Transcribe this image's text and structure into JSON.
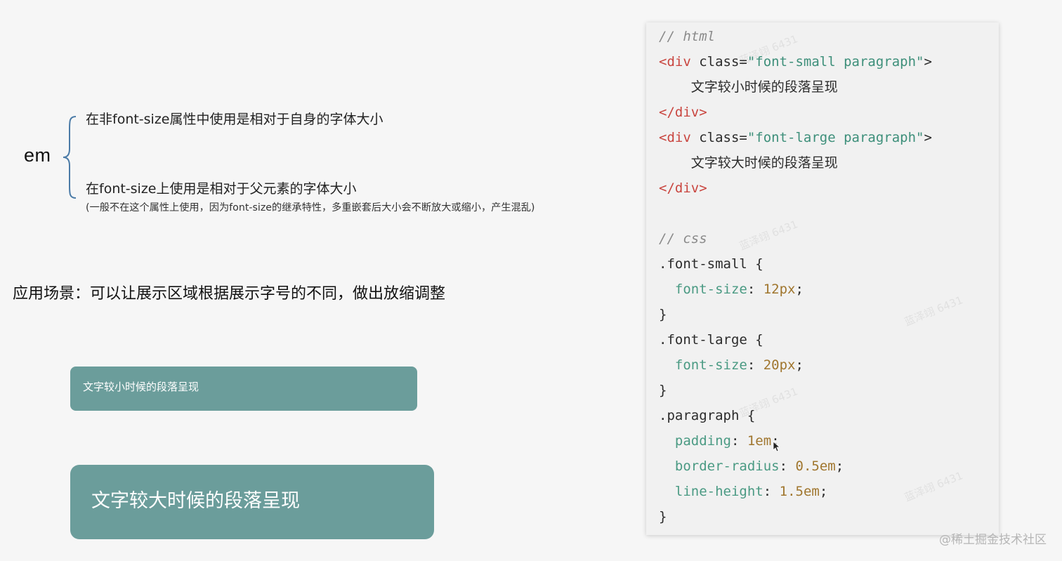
{
  "left": {
    "em_label": "em",
    "point_1": "在非font-size属性中使用是相对于自身的字体大小",
    "point_2": "在font-size上使用是相对于父元素的字体大小",
    "point_2_note": "(一般不在这个属性上使用，因为font-size的继承特性，多重嵌套后大小会不断放大或缩小，产生混乱)",
    "scenario": "应用场景：可以让展示区域根据展示字号的不同，做出放缩调整",
    "box_small_text": "文字较小时候的段落呈现",
    "box_large_text": "文字较大时候的段落呈现",
    "box_color": "#6b9d9b"
  },
  "code": {
    "html_comment": "// html",
    "div_open": "<div",
    "class_attr": " class=",
    "class_small": "\"font-small paragraph\"",
    "class_large": "\"font-large paragraph\"",
    "tag_close": ">",
    "text_small": "文字较小时候的段落呈现",
    "text_large": "文字较大时候的段落呈现",
    "div_close": "</div>",
    "css_comment": "// css",
    "sel_small": ".font-small {",
    "sel_large": ".font-large {",
    "sel_paragraph": ".paragraph {",
    "prop_font_size": "font-size",
    "val_12": "12px",
    "val_20": "20px",
    "prop_padding": "padding",
    "val_1em": "1em",
    "prop_radius": "border-radius",
    "val_05em": "0.5em",
    "prop_line_height": "line-height",
    "val_15em": "1.5em",
    "brace_close": "}"
  },
  "watermark_text": "蓝泽翊 6431",
  "site_mark": "@稀土掘金技术社区"
}
